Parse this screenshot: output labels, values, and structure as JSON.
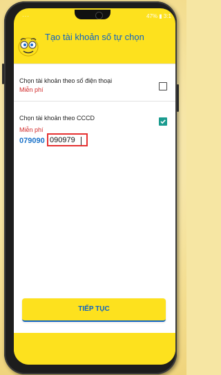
{
  "app": {
    "title": "Tạo tài khoản số tự chọn"
  },
  "status_bar": {
    "left_text": "···",
    "right_text": "47% ▮ 3:1"
  },
  "options": [
    {
      "label": "Chọn tài khoản theo số điện thoại",
      "price": "Miễn phí",
      "checked": false
    },
    {
      "label": "Chọn tài khoản theo CCCD",
      "price": "Miễn phí",
      "checked": true
    }
  ],
  "account_input": {
    "prefix": "079090",
    "value": "090979"
  },
  "continue_button": {
    "label": "TIẾP TỤC"
  },
  "colors": {
    "brand_yellow": "#fde11e",
    "brand_blue": "#0c62c7",
    "price_red": "#d12a2a",
    "check_teal": "#1a9b8f",
    "highlight_red": "#e53030"
  }
}
